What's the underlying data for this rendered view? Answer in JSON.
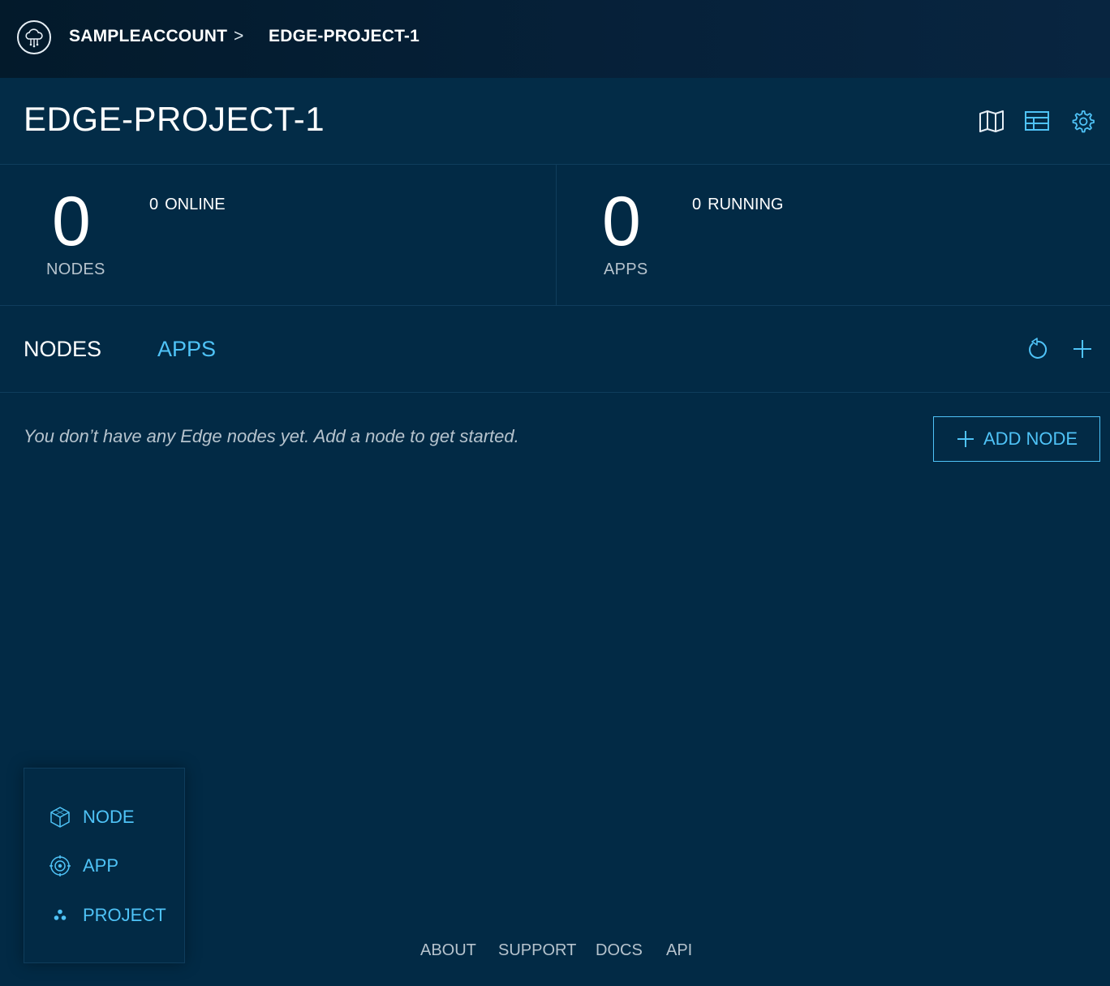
{
  "breadcrumb": {
    "account": "SAMPLEACCOUNT",
    "separator": ">",
    "project": "EDGE-PROJECT-1"
  },
  "header": {
    "title": "EDGE-PROJECT-1",
    "icons": [
      "map-icon",
      "table-icon",
      "gear-icon"
    ]
  },
  "stats": {
    "nodes": {
      "count": "0",
      "label": "NODES",
      "online_count": "0",
      "online_label": "ONLINE"
    },
    "apps": {
      "count": "0",
      "label": "APPS",
      "running_count": "0",
      "running_label": "RUNNING"
    }
  },
  "tabs": {
    "nodes": "NODES",
    "apps": "APPS"
  },
  "toolbar": {
    "icons": [
      "refresh-icon",
      "plus-icon"
    ]
  },
  "empty_state": {
    "message": "You don’t have any Edge nodes yet. Add a node to get started.",
    "button": "ADD NODE"
  },
  "create_menu": {
    "items": [
      {
        "label": "NODE",
        "icon": "cube-icon"
      },
      {
        "label": "APP",
        "icon": "app-icon"
      },
      {
        "label": "PROJECT",
        "icon": "project-icon"
      }
    ]
  },
  "footer": {
    "links": [
      "ABOUT",
      "SUPPORT",
      "DOCS",
      "API"
    ]
  },
  "colors": {
    "background": "#022a45",
    "topbar": "#06213a",
    "accent": "#4fc3f7",
    "muted_text": "#b6c3cd"
  }
}
